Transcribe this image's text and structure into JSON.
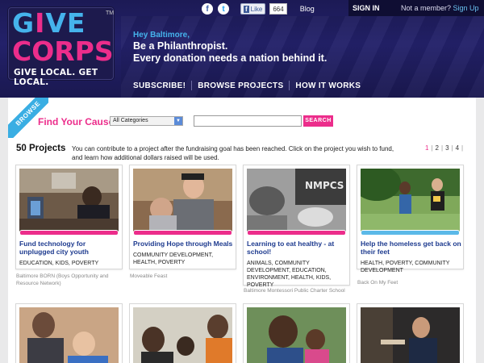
{
  "logo": {
    "give_g": "G",
    "give_i": "I",
    "give_ve": "VE",
    "corps": "CORPS",
    "tm": "TM",
    "tagline": "GIVE LOCAL. GET LOCAL."
  },
  "topbar": {
    "facebook_glyph": "f",
    "twitter_glyph": "t",
    "fb_like_label": "Like",
    "fb_like_count": "664",
    "blog_label": "Blog"
  },
  "auth": {
    "sign_in": "SIGN IN",
    "member_prompt": "Not a member?",
    "sign_up": "Sign Up"
  },
  "hero": {
    "greeting": "Hey Baltimore,",
    "line1": "Be a Philanthropist.",
    "line2": "Every donation needs a nation behind it."
  },
  "nav": {
    "items": [
      "SUBSCRIBE!",
      "BROWSE PROJECTS",
      "HOW IT WORKS"
    ]
  },
  "browse": {
    "ribbon": "BROWSE",
    "find_label": "Find Your Cause!",
    "category_selected": "All Categories",
    "search_value": "",
    "search_button": "SEARCH"
  },
  "projects": {
    "count_label": "50 Projects",
    "description": "You can contribute to a project after the fundraising goal has been reached. Click on the project you wish to fund, and learn how additional dollars raised will be used.",
    "pages": [
      "1",
      "2",
      "3",
      "4"
    ],
    "current_page": "1",
    "cards": [
      {
        "title": "Fund technology for unplugged city youth",
        "tags": "EDUCATION, KIDS, POVERTY",
        "org": "Baltimore BORN (Boys Opportunity and Resource Network)",
        "bar_color": "#ec2d8b"
      },
      {
        "title": "Providing Hope through Meals",
        "tags": "COMMUNITY DEVELOPMENT, HEALTH, POVERTY",
        "org": "Moveable Feast",
        "bar_color": "#ec2d8b"
      },
      {
        "title": "Learning to eat healthy - at school!",
        "tags": "ANIMALS, COMMUNITY DEVELOPMENT, EDUCATION, ENVIRONMENT, HEALTH, KIDS, POVERTY",
        "org": "Baltimore Montessori Public Charter School",
        "bar_color": "#ec2d8b"
      },
      {
        "title": "Help the homeless get back on their feet",
        "tags": "HEALTH, POVERTY, COMMUNITY DEVELOPMENT",
        "org": "Back On My Feet",
        "bar_color": "#5bb9e8"
      }
    ],
    "photo_caption": "NMPCS"
  },
  "colors": {
    "brand_pink": "#ec2d8b",
    "brand_blue": "#45b3ec",
    "header_navy": "#1c1a55",
    "link_blue": "#1e3b8f"
  }
}
